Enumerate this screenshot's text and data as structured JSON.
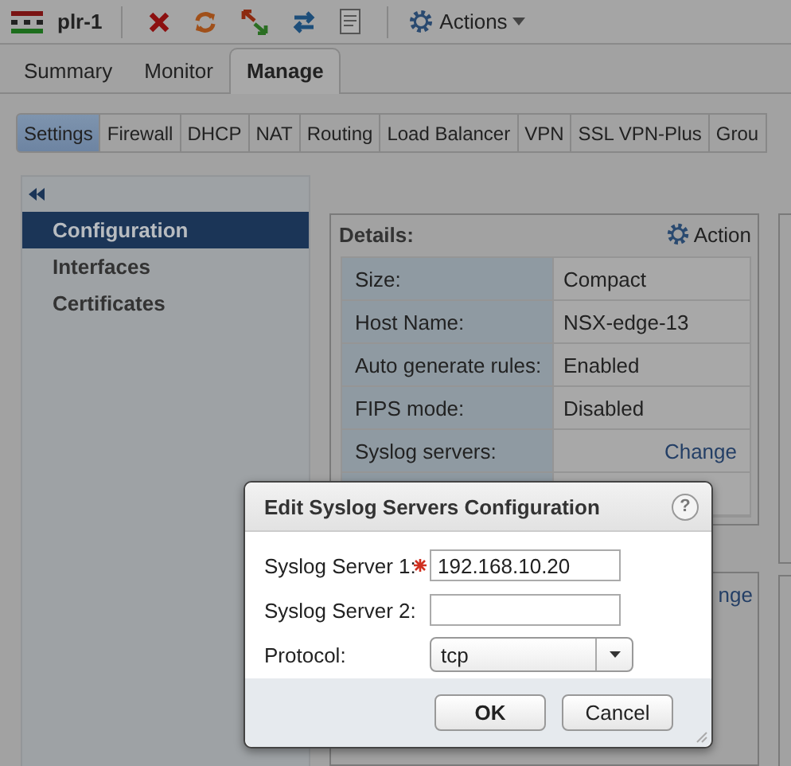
{
  "toolbar": {
    "object_name": "plr-1",
    "actions_label": "Actions"
  },
  "main_tabs": [
    {
      "label": "Summary",
      "selected": false
    },
    {
      "label": "Monitor",
      "selected": false
    },
    {
      "label": "Manage",
      "selected": true
    }
  ],
  "sub_tabs": [
    {
      "label": "Settings",
      "selected": true
    },
    {
      "label": "Firewall",
      "selected": false
    },
    {
      "label": "DHCP",
      "selected": false
    },
    {
      "label": "NAT",
      "selected": false
    },
    {
      "label": "Routing",
      "selected": false
    },
    {
      "label": "Load Balancer",
      "selected": false
    },
    {
      "label": "VPN",
      "selected": false
    },
    {
      "label": "SSL VPN-Plus",
      "selected": false
    },
    {
      "label": "Grou",
      "selected": false
    }
  ],
  "sidebar": {
    "items": [
      {
        "label": "Configuration",
        "selected": true
      },
      {
        "label": "Interfaces",
        "selected": false
      },
      {
        "label": "Certificates",
        "selected": false
      }
    ]
  },
  "details": {
    "title": "Details:",
    "action_label": "Action",
    "rows": [
      {
        "label": "Size:",
        "value": "Compact",
        "kind": "text"
      },
      {
        "label": "Host Name:",
        "value": "NSX-edge-13",
        "kind": "text"
      },
      {
        "label": "Auto generate rules:",
        "value": "Enabled",
        "kind": "text"
      },
      {
        "label": "FIPS mode:",
        "value": "Disabled",
        "kind": "text"
      },
      {
        "label": "Syslog servers:",
        "value": "Change",
        "kind": "link"
      }
    ]
  },
  "second_panel": {
    "link": "nge"
  },
  "dialog": {
    "title": "Edit Syslog Servers Configuration",
    "help": "?",
    "fields": [
      {
        "label": "Syslog Server 1:",
        "required": true,
        "value": "192.168.10.20",
        "kind": "text"
      },
      {
        "label": "Syslog Server 2:",
        "required": false,
        "kind": "text"
      },
      {
        "label": "Protocol:",
        "required": false,
        "value": "tcp",
        "kind": "select"
      }
    ],
    "buttons": [
      {
        "label": "OK",
        "primary": true
      },
      {
        "label": "Cancel",
        "primary": false
      }
    ]
  }
}
